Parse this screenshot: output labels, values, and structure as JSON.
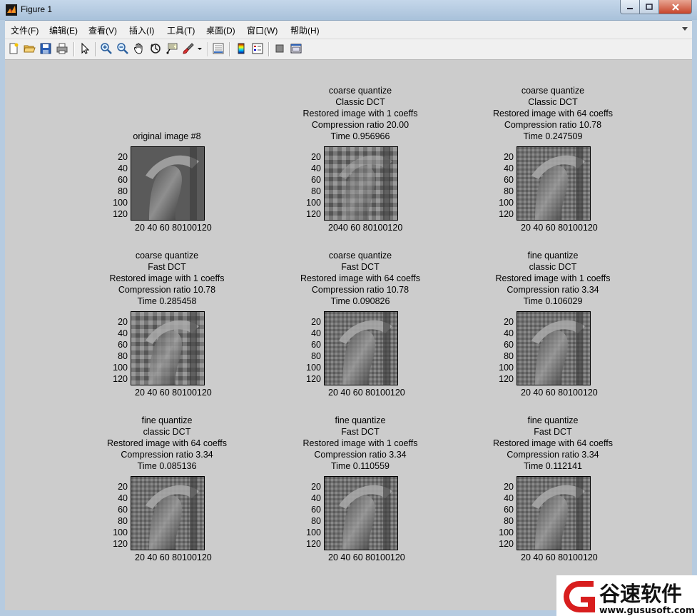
{
  "window": {
    "title": "Figure 1"
  },
  "menu": [
    "文件(F)",
    "编辑(E)",
    "查看(V)",
    "插入(I)",
    "工具(T)",
    "桌面(D)",
    "窗口(W)",
    "帮助(H)"
  ],
  "toolbar": [
    "new-figure-icon",
    "open-icon",
    "save-icon",
    "print-icon",
    "pointer-icon",
    "zoom-in-icon",
    "zoom-out-icon",
    "pan-icon",
    "rotate-icon",
    "data-cursor-icon",
    "brush-icon",
    "link-icon",
    "colorbar-icon",
    "legend-icon",
    "hide-plot-tools-icon",
    "show-plot-tools-icon"
  ],
  "axes": {
    "yticks": [
      "20",
      "40",
      "60",
      "80",
      "100",
      "120"
    ],
    "xticks": "20 40 60 80100120",
    "xticks_tight": "2040 60 80100120"
  },
  "subplots": [
    {
      "title": [
        "original image #8"
      ]
    },
    {
      "title": [
        "coarse quantize",
        "Classic DCT",
        "Restored image with 1 coeffs",
        "Compression ratio 20.00",
        "Time 0.956966"
      ]
    },
    {
      "title": [
        "coarse quantize",
        "Classic DCT",
        "Restored image with 64 coeffs",
        "Compression ratio 10.78",
        "Time 0.247509"
      ]
    },
    {
      "title": [
        "coarse quantize",
        "Fast DCT",
        "Restored image with 1 coeffs",
        "Compression ratio 10.78",
        "Time 0.285458"
      ]
    },
    {
      "title": [
        "coarse quantize",
        "Fast DCT",
        "Restored image with 64 coeffs",
        "Compression ratio 10.78",
        "Time 0.090826"
      ]
    },
    {
      "title": [
        "fine quantize",
        "classic DCT",
        "Restored image with 1 coeffs",
        "Compression ratio 3.34",
        "Time 0.106029"
      ]
    },
    {
      "title": [
        "fine quantize",
        "classic DCT",
        "Restored image with 64 coeffs",
        "Compression ratio 3.34",
        "Time 0.085136"
      ]
    },
    {
      "title": [
        "fine quantize",
        "Fast DCT",
        "Restored image with 1 coeffs",
        "Compression ratio 3.34",
        "Time 0.110559"
      ]
    },
    {
      "title": [
        "fine quantize",
        "Fast DCT",
        "Restored image with 64 coeffs",
        "Compression ratio 3.34",
        "Time 0.112141"
      ]
    }
  ],
  "watermark": {
    "name": "谷速软件",
    "url": "www.gususoft.com"
  }
}
